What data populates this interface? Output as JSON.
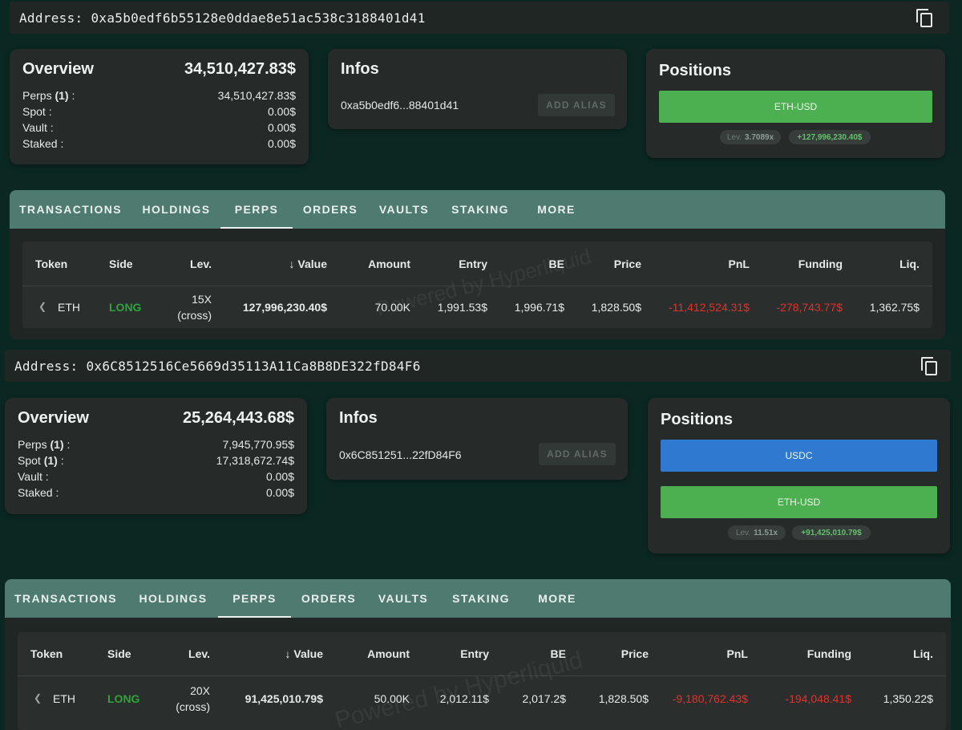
{
  "wallets": [
    {
      "address_label": "Address:",
      "address": "0xa5b0edf6b55128e0ddae8e51ac538c3188401d41",
      "overview": {
        "title": "Overview",
        "total": "34,510,427.83$",
        "rows": [
          {
            "label": "Perps",
            "count": "(1)",
            "suffix": " :",
            "value": "34,510,427.83$"
          },
          {
            "label": "Spot",
            "count": "",
            "suffix": " :",
            "value": "0.00$"
          },
          {
            "label": "Vault",
            "count": "",
            "suffix": " :",
            "value": "0.00$"
          },
          {
            "label": "Staked",
            "count": "",
            "suffix": " :",
            "value": "0.00$"
          }
        ]
      },
      "infos": {
        "title": "Infos",
        "short_address": "0xa5b0edf6...88401d41",
        "alias_button": "ADD ALIAS"
      },
      "positions": {
        "title": "Positions",
        "buttons": [
          {
            "label": "ETH-USD",
            "color": "#4caf50"
          }
        ],
        "lev_label": "Lev.",
        "lev_value": "3.7089x",
        "pnl": "+127,996,230.40$"
      },
      "tabs": [
        "TRANSACTIONS",
        "HOLDINGS",
        "PERPS",
        "ORDERS",
        "VAULTS",
        "STAKING",
        "MORE"
      ],
      "active_tab": "PERPS",
      "table": {
        "headers": [
          "Token",
          "Side",
          "Lev.",
          "↓ Value",
          "Amount",
          "Entry",
          "BE",
          "Price",
          "PnL",
          "Funding",
          "Liq."
        ],
        "rows": [
          {
            "token": "ETH",
            "side": "LONG",
            "lev": "15X",
            "lev_mode": "(cross)",
            "value": "127,996,230.40$",
            "amount": "70.00K",
            "entry": "1,991.53$",
            "be": "1,996.71$",
            "price": "1,828.50$",
            "pnl": "-11,412,524.31$",
            "funding": "-278,743.77$",
            "liq": "1,362.75$"
          }
        ]
      },
      "watermark": "Powered by Hyperliquid"
    },
    {
      "address_label": "Address:",
      "address": "0x6C8512516Ce5669d35113A11Ca8B8DE322fD84F6",
      "overview": {
        "title": "Overview",
        "total": "25,264,443.68$",
        "rows": [
          {
            "label": "Perps",
            "count": "(1)",
            "suffix": " :",
            "value": "7,945,770.95$"
          },
          {
            "label": "Spot",
            "count": "(1)",
            "suffix": " :",
            "value": "17,318,672.74$"
          },
          {
            "label": "Vault",
            "count": "",
            "suffix": " :",
            "value": "0.00$"
          },
          {
            "label": "Staked",
            "count": "",
            "suffix": " :",
            "value": "0.00$"
          }
        ]
      },
      "infos": {
        "title": "Infos",
        "short_address": "0x6C851251...22fD84F6",
        "alias_button": "ADD ALIAS"
      },
      "positions": {
        "title": "Positions",
        "buttons": [
          {
            "label": "USDC",
            "color": "#2f79d0"
          },
          {
            "label": "ETH-USD",
            "color": "#4caf50"
          }
        ],
        "lev_label": "Lev.",
        "lev_value": "11.51x",
        "pnl": "+91,425,010.79$"
      },
      "tabs": [
        "TRANSACTIONS",
        "HOLDINGS",
        "PERPS",
        "ORDERS",
        "VAULTS",
        "STAKING",
        "MORE"
      ],
      "active_tab": "PERPS",
      "table": {
        "headers": [
          "Token",
          "Side",
          "Lev.",
          "↓ Value",
          "Amount",
          "Entry",
          "BE",
          "Price",
          "PnL",
          "Funding",
          "Liq."
        ],
        "rows": [
          {
            "token": "ETH",
            "side": "LONG",
            "lev": "20X",
            "lev_mode": "(cross)",
            "value": "91,425,010.79$",
            "amount": "50.00K",
            "entry": "2,012.11$",
            "be": "2,017.2$",
            "price": "1,828.50$",
            "pnl": "-9,180,762.43$",
            "funding": "-194,048.41$",
            "liq": "1,350.22$"
          }
        ]
      },
      "watermark": "Powered by Hyperliquid"
    }
  ]
}
